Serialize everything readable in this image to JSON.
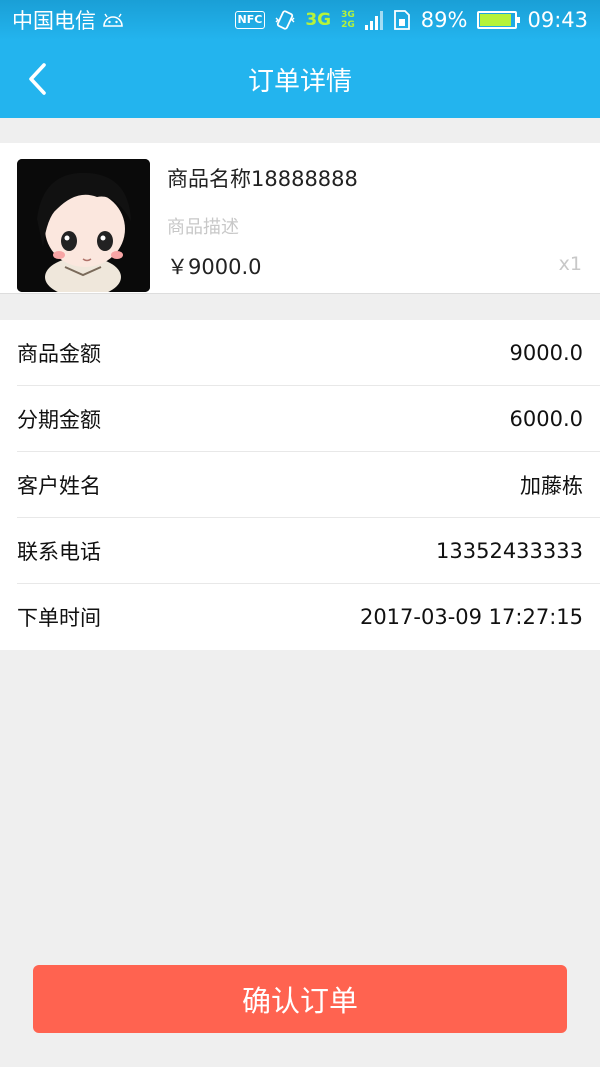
{
  "status_bar": {
    "carrier": "中国电信",
    "nfc": "NFC",
    "network": "3G",
    "network_secondary": [
      "3G",
      "2G"
    ],
    "battery_percent": "89%",
    "battery_level": 0.89,
    "time": "09:43"
  },
  "nav": {
    "title": "订单详情",
    "back_icon": "chevron-left-icon"
  },
  "product": {
    "name": "商品名称18888888",
    "description": "商品描述",
    "price": "￥9000.0",
    "quantity": "x1",
    "image_icon": "avatar-cartoon-girl"
  },
  "details": [
    {
      "label": "商品金额",
      "value": "9000.0"
    },
    {
      "label": "分期金额",
      "value": "6000.0"
    },
    {
      "label": "客户姓名",
      "value": "加藤栋"
    },
    {
      "label": "联系电话",
      "value": "13352433333"
    },
    {
      "label": "下单时间",
      "value": "2017-03-09 17:27:15"
    }
  ],
  "confirm_button": {
    "label": "确认订单"
  },
  "colors": {
    "primary": "#23b4ee",
    "accent": "#ff6350",
    "background": "#efefef",
    "muted_text": "#c8c8c8"
  }
}
